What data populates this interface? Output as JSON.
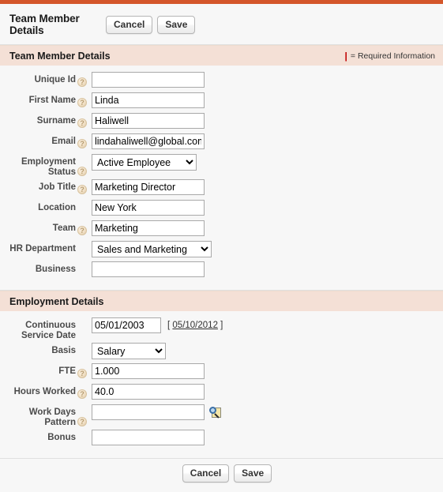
{
  "window": {
    "title": "Team Member Details",
    "accent_color": "#d4562a",
    "section_bar_color": "#f4e0d6"
  },
  "header": {
    "title": "Team Member Details",
    "cancel_label": "Cancel",
    "save_label": "Save"
  },
  "legend": {
    "marker": "|",
    "text": "= Required Information",
    "marker_color": "#c00000"
  },
  "sections": [
    {
      "title": "Team Member Details",
      "fields": [
        {
          "label": "Unique Id",
          "help": true,
          "type": "text",
          "value": "",
          "icon": "help-icon"
        },
        {
          "label": "First Name",
          "help": true,
          "type": "text",
          "value": "Linda",
          "icon": "help-icon"
        },
        {
          "label": "Surname",
          "help": true,
          "type": "text",
          "value": "Haliwell",
          "icon": "help-icon"
        },
        {
          "label": "Email",
          "help": true,
          "type": "text",
          "value": "lindahaliwell@global.com",
          "icon": "help-icon"
        },
        {
          "label": "Employment Status",
          "help": true,
          "type": "select",
          "value": "Active Employee",
          "options": [
            "Active Employee"
          ],
          "icon": "help-icon"
        },
        {
          "label": "Job Title",
          "help": true,
          "type": "text",
          "value": "Marketing Director",
          "icon": "help-icon"
        },
        {
          "label": "Location",
          "help": false,
          "type": "text",
          "value": "New York"
        },
        {
          "label": "Team",
          "help": true,
          "type": "text",
          "value": "Marketing",
          "icon": "help-icon"
        },
        {
          "label": "HR Department",
          "help": false,
          "type": "select",
          "value": "Sales and Marketing",
          "options": [
            "Sales and Marketing"
          ]
        },
        {
          "label": "Business",
          "help": false,
          "type": "text",
          "value": ""
        }
      ]
    },
    {
      "title": "Employment Details",
      "fields": [
        {
          "label": "Continuous Service Date",
          "help": false,
          "type": "date",
          "value": "05/01/2003",
          "link_open": "[",
          "link_text": "05/10/2012",
          "link_close": "]"
        },
        {
          "label": "Basis",
          "help": false,
          "type": "select",
          "value": "Salary",
          "options": [
            "Salary"
          ]
        },
        {
          "label": "FTE",
          "help": true,
          "type": "text",
          "value": "1.000",
          "icon": "help-icon"
        },
        {
          "label": "Hours Worked",
          "help": true,
          "type": "text",
          "value": "40.0",
          "icon": "help-icon"
        },
        {
          "label": "Work Days Pattern",
          "help": true,
          "type": "text",
          "value": "",
          "icon": "help-icon",
          "lookup": true,
          "lookup_icon": "lookup-magnifier-icon"
        },
        {
          "label": "Bonus",
          "help": false,
          "type": "text",
          "value": ""
        }
      ]
    }
  ],
  "footer": {
    "cancel_label": "Cancel",
    "save_label": "Save"
  }
}
